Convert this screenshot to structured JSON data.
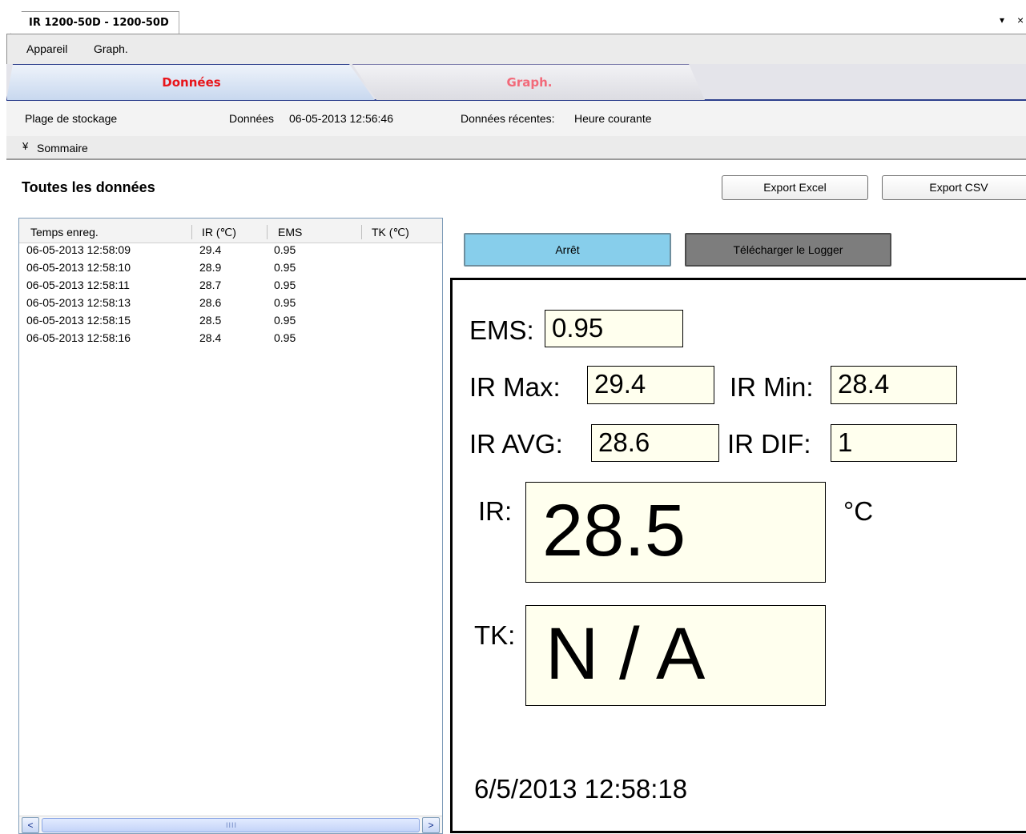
{
  "document_tab": {
    "title": "IR 1200-50D - 1200-50D",
    "menu_arrow": "▾",
    "close": "×"
  },
  "menubar": {
    "items": [
      "Appareil",
      "Graph."
    ]
  },
  "view_tabs": [
    {
      "label": "Données",
      "active": true,
      "color": "#e8141a"
    },
    {
      "label": "Graph.",
      "active": false,
      "color": "#f26a7a"
    }
  ],
  "info": {
    "storage_label": "Plage de stockage",
    "data_label": "Données",
    "data_value": "06-05-2013 12:56:46",
    "recent_label": "Données récentes:",
    "recent_value": "Heure courante"
  },
  "summary": {
    "chevron": "¥",
    "label": "Sommaire"
  },
  "section_title": "Toutes les données",
  "buttons": {
    "export_excel": "Export Excel",
    "export_csv": "Export CSV",
    "stop": "Arrêt",
    "download": "Télécharger le Logger"
  },
  "table": {
    "headers": [
      "Temps enreg.",
      "IR (℃)",
      "EMS",
      "TK (℃)"
    ],
    "rows": [
      [
        "06-05-2013 12:58:09",
        "29.4",
        "0.95",
        ""
      ],
      [
        "06-05-2013 12:58:10",
        "28.9",
        "0.95",
        ""
      ],
      [
        "06-05-2013 12:58:11",
        "28.7",
        "0.95",
        ""
      ],
      [
        "06-05-2013 12:58:13",
        "28.6",
        "0.95",
        ""
      ],
      [
        "06-05-2013 12:58:15",
        "28.5",
        "0.95",
        ""
      ],
      [
        "06-05-2013 12:58:16",
        "28.4",
        "0.95",
        ""
      ]
    ],
    "scroll_left": "<",
    "scroll_right": ">",
    "scroll_grip": "IIII"
  },
  "display": {
    "ems_label": "EMS:",
    "ems_value": "0.95",
    "ir_max_label": "IR Max:",
    "ir_max_value": "29.4",
    "ir_min_label": "IR Min:",
    "ir_min_value": "28.4",
    "ir_avg_label": "IR AVG:",
    "ir_avg_value": "28.6",
    "ir_dif_label": "IR DIF:",
    "ir_dif_value": "1",
    "ir_label": "IR:",
    "ir_value": "28.5",
    "unit": "°C",
    "tk_label": "TK:",
    "tk_value": "N / A",
    "timestamp": "6/5/2013 12:58:18"
  }
}
